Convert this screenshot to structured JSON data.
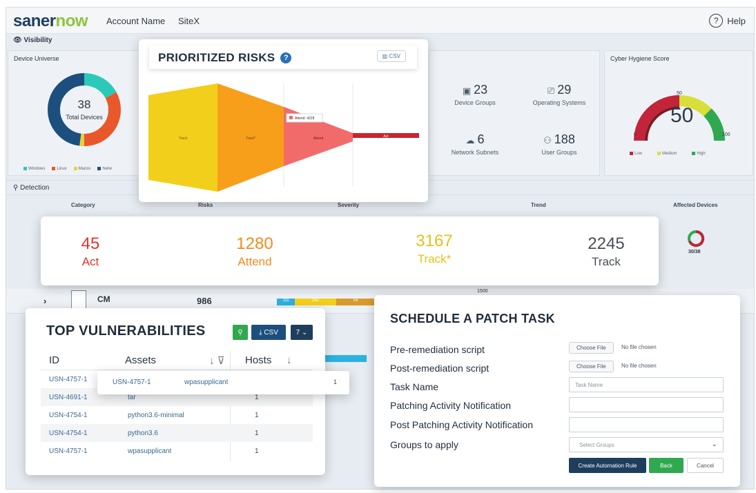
{
  "header": {
    "logo_part1": "saner",
    "logo_part2": "now",
    "account": "Account Name",
    "site": "SiteX",
    "help": "Help"
  },
  "visibility": {
    "section_label": "Visibility",
    "device_universe": {
      "title": "Device Universe",
      "total": "38",
      "total_label": "Total Devices",
      "legend": [
        "Windows",
        "Linux",
        "Macos",
        "Netw"
      ],
      "segments": [
        {
          "label": "Windows",
          "value": 0.17,
          "color": "#2cc9b8"
        },
        {
          "label": "Linux",
          "value": 0.33,
          "color": "#e8582a"
        },
        {
          "label": "Macos",
          "value": 0.02,
          "color": "#e6d23a"
        },
        {
          "label": "Netw",
          "value": 0.48,
          "color": "#1c4f7d"
        }
      ]
    },
    "stats": [
      {
        "icon": "device-groups-icon",
        "glyph": "▣",
        "value": "23",
        "label": "Device Groups"
      },
      {
        "icon": "operating-systems-icon",
        "glyph": "⎚",
        "value": "29",
        "label": "Operating Systems"
      },
      {
        "icon": "network-subnets-icon",
        "glyph": "☁",
        "value": "6",
        "label": "Network Subnets"
      },
      {
        "icon": "user-groups-icon",
        "glyph": "⚇",
        "value": "188",
        "label": "User Groups"
      }
    ],
    "cyber_hygiene": {
      "title": "Cyber Hygiene Score",
      "score": "50",
      "tick_min": "0",
      "tick_mid": "50",
      "tick_max": "100",
      "legend": [
        "Low",
        "Medium",
        "High"
      ],
      "colors": {
        "low": "#c2243a",
        "medium": "#d8de3a",
        "high": "#2fa84f"
      },
      "level": 0.5
    }
  },
  "detection": {
    "section_label": "Detection",
    "columns": [
      "Category",
      "Risks",
      "Severity",
      "Trend",
      "Affected Devices"
    ],
    "affected_devices": "30/38",
    "cm_row": {
      "category": "CM",
      "risks": "986",
      "trend_tick": "1500",
      "bar_labels": [
        "111",
        "242",
        "54"
      ]
    }
  },
  "prioritized_risks": {
    "title": "PRIORITIZED RISKS",
    "csv_label": "CSV",
    "stages": [
      "Track",
      "Track*",
      "Attend",
      "Act"
    ],
    "tooltip": "Attend: 4228",
    "colors": [
      "#f2cf1a",
      "#f79e1b",
      "#f26b6b",
      "#c9252f"
    ]
  },
  "counts": [
    {
      "value": "45",
      "label": "Act",
      "color": "#e5332a"
    },
    {
      "value": "1280",
      "label": "Attend",
      "color": "#f28a1c"
    },
    {
      "value": "3167",
      "label": "Track*",
      "color": "#e3c21a"
    },
    {
      "value": "2245",
      "label": "Track",
      "color": "#4a4f55"
    }
  ],
  "top_vulnerabilities": {
    "title": "TOP VULNERABILITIES",
    "csv_label": "CSV",
    "page_size": "7",
    "columns": [
      "ID",
      "Assets",
      "Hosts"
    ],
    "rows": [
      {
        "id": "USN-4757-1",
        "asset": "",
        "hosts": ""
      },
      {
        "id": "USN-4691-1",
        "asset": "tar",
        "hosts": "1"
      },
      {
        "id": "USN-4754-1",
        "asset": "python3.6-minimal",
        "hosts": "1"
      },
      {
        "id": "USN-4754-1",
        "asset": "python3.6",
        "hosts": "1"
      },
      {
        "id": "USN-4757-1",
        "asset": "wpasupplicant",
        "hosts": "1"
      }
    ],
    "popup_row": {
      "id": "USN-4757-1",
      "asset": "wpasupplicant",
      "hosts": "1"
    }
  },
  "schedule_patch": {
    "title": "SCHEDULE A PATCH TASK",
    "pre_script_label": "Pre-remediation script",
    "post_script_label": "Post-remediation script",
    "choose_file": "Choose File",
    "no_file": "No file chosen",
    "task_name_label": "Task Name",
    "task_name_placeholder": "Task Name",
    "patching_notif_label": "Patching Activity Notification",
    "post_patching_notif_label": "Post Patching Activity Notification",
    "groups_label": "Groups to apply",
    "groups_placeholder": "Select Groups",
    "btn_create": "Create Automation Rule",
    "btn_back": "Back",
    "btn_cancel": "Cancel"
  }
}
